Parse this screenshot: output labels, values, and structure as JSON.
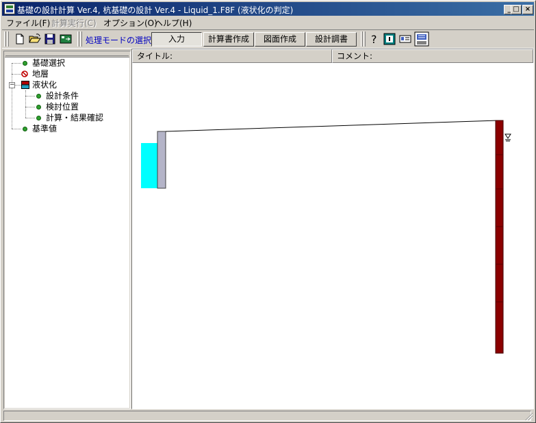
{
  "window": {
    "title": "基礎の設計計算 Ver.4, 杭基礎の設計 Ver.4 - Liquid_1.F8F (液状化の判定)",
    "controls": [
      "_",
      "□",
      "×"
    ]
  },
  "menu": [
    {
      "label": "ファイル(F)",
      "enabled": true
    },
    {
      "label": "計算実行(C)",
      "enabled": false
    },
    {
      "label": "オプション(O)",
      "enabled": true
    },
    {
      "label": "ヘルプ(H)",
      "enabled": true
    }
  ],
  "toolbar": {
    "icons": [
      "new-file-icon",
      "open-folder-icon",
      "save-disk-icon",
      "calc-run-icon"
    ],
    "mode_label": "処理モードの選択",
    "mode_buttons": [
      {
        "label": "入力",
        "pressed": true
      },
      {
        "label": "計算書作成",
        "pressed": false
      },
      {
        "label": "図面作成",
        "pressed": false
      },
      {
        "label": "設計調書",
        "pressed": false
      }
    ],
    "help_icons": [
      "help-question-icon",
      "monitor-icon",
      "card-icon",
      "export-icon"
    ]
  },
  "tree": {
    "items": [
      {
        "label": "基礎選択",
        "icon": "green-dot-icon",
        "level": 0
      },
      {
        "label": "地層",
        "icon": "no-entry-icon",
        "level": 0
      },
      {
        "label": "液状化",
        "icon": "liquefaction-icon",
        "level": 0,
        "expanded": true
      },
      {
        "label": "設計条件",
        "icon": "green-dot-icon",
        "level": 1
      },
      {
        "label": "検討位置",
        "icon": "green-dot-icon",
        "level": 1
      },
      {
        "label": "計算・結果確認",
        "icon": "green-dot-icon",
        "level": 1
      },
      {
        "label": "基準値",
        "icon": "green-dot-icon",
        "level": 0
      }
    ]
  },
  "main": {
    "title_label": "タイトル:",
    "comment_label": "コメント:",
    "water_level_symbol": "▽",
    "colors": {
      "water": "#00ffff",
      "wall": "#b4b4c8",
      "pile": "#8b0000",
      "ground_line": "#000000"
    }
  }
}
